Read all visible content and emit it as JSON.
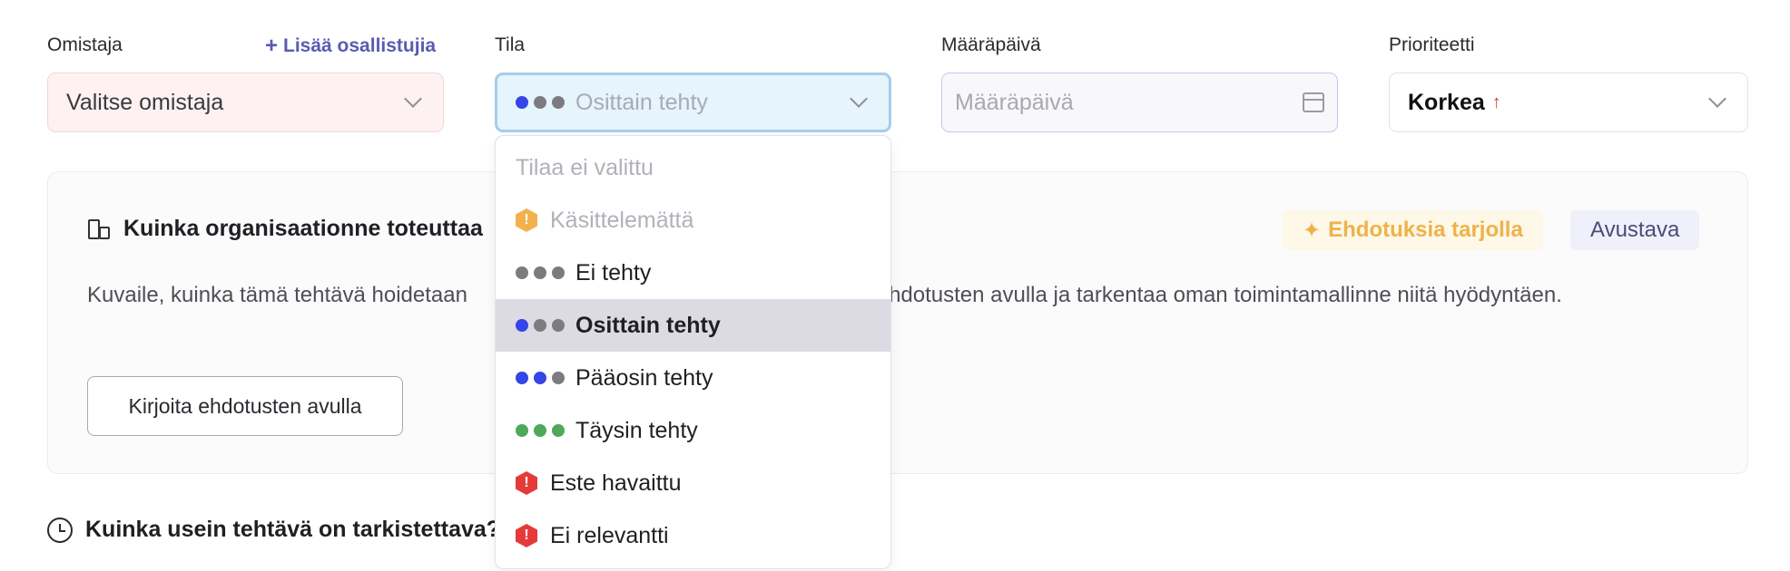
{
  "labels": {
    "owner": "Omistaja",
    "add_participants": "Lisää osallistujia",
    "state": "Tila",
    "due_date": "Määräpäivä",
    "priority": "Prioriteetti"
  },
  "fields": {
    "owner_placeholder": "Valitse omistaja",
    "state_value": "Osittain tehty",
    "due_placeholder": "Määräpäivä",
    "priority_value": "Korkea",
    "priority_arrow": "↑"
  },
  "card": {
    "title": "Kuinka organisaationne toteuttaa",
    "description": "Kuvaile, kuinka tämä tehtävä hoidetaan                                                        miiden ehdotusten avulla ja tarkentaa oman toimintamallinne niitä hyödyntäen.",
    "write_button": "Kirjoita ehdotusten avulla",
    "suggestions_badge": "Ehdotuksia tarjolla",
    "assist_badge": "Avustava"
  },
  "question": "Kuinka usein tehtävä on tarkistettava?",
  "dropdown": {
    "options": [
      {
        "label": "Tilaa ei valittu"
      },
      {
        "label": "Käsittelemättä"
      },
      {
        "label": "Ei tehty"
      },
      {
        "label": "Osittain tehty"
      },
      {
        "label": "Pääosin tehty"
      },
      {
        "label": "Täysin tehty"
      },
      {
        "label": "Este havaittu"
      },
      {
        "label": "Ei relevantti"
      }
    ],
    "selected": "Osittain tehty"
  },
  "colors": {
    "progress_blue": "#3446e8",
    "progress_gray": "#7b7b80",
    "done_green": "#4fa85c",
    "warning_orange": "#f3b14e",
    "error_red": "#e53a3a"
  }
}
